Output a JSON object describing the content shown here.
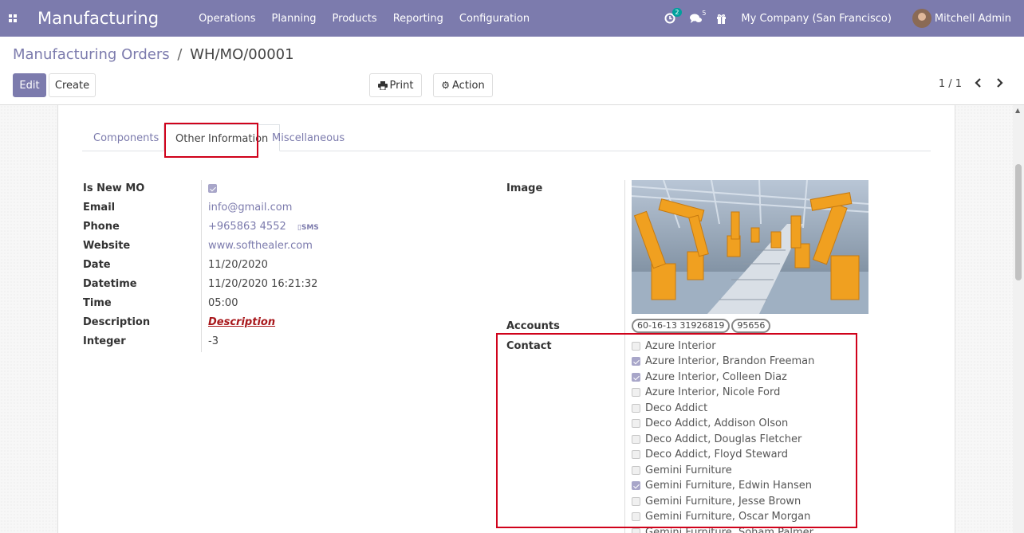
{
  "navbar": {
    "brand": "Manufacturing",
    "menu": [
      "Operations",
      "Planning",
      "Products",
      "Reporting",
      "Configuration"
    ],
    "activities_count": "2",
    "messages_count": "5",
    "company": "My Company (San Francisco)",
    "user": "Mitchell Admin"
  },
  "breadcrumb": {
    "parent": "Manufacturing Orders",
    "separator": "/",
    "current": "WH/MO/00001"
  },
  "buttons": {
    "edit": "Edit",
    "create": "Create",
    "print": "Print",
    "action": "Action"
  },
  "pager": {
    "value": "1 / 1"
  },
  "tabs": [
    "Components",
    "Other Information",
    "Miscellaneous"
  ],
  "fields": {
    "is_new_mo": {
      "label": "Is New MO",
      "checked": true
    },
    "email": {
      "label": "Email",
      "value": "info@gmail.com"
    },
    "phone": {
      "label": "Phone",
      "value": "+965863 4552",
      "sms": "SMS"
    },
    "website": {
      "label": "Website",
      "value": "www.softhealer.com"
    },
    "date": {
      "label": "Date",
      "value": "11/20/2020"
    },
    "datetime": {
      "label": "Datetime",
      "value": "11/20/2020 16:21:32"
    },
    "time": {
      "label": "Time",
      "value": "05:00"
    },
    "description": {
      "label": "Description",
      "value": "Description"
    },
    "integer": {
      "label": "Integer",
      "value": "-3"
    },
    "image": {
      "label": "Image"
    },
    "accounts": {
      "label": "Accounts",
      "tags": [
        "60-16-13 31926819",
        "95656"
      ]
    },
    "contact": {
      "label": "Contact"
    }
  },
  "contacts": [
    {
      "name": "Azure Interior",
      "checked": false
    },
    {
      "name": "Azure Interior, Brandon Freeman",
      "checked": true
    },
    {
      "name": "Azure Interior, Colleen Diaz",
      "checked": true
    },
    {
      "name": "Azure Interior, Nicole Ford",
      "checked": false
    },
    {
      "name": "Deco Addict",
      "checked": false
    },
    {
      "name": "Deco Addict, Addison Olson",
      "checked": false
    },
    {
      "name": "Deco Addict, Douglas Fletcher",
      "checked": false
    },
    {
      "name": "Deco Addict, Floyd Steward",
      "checked": false
    },
    {
      "name": "Gemini Furniture",
      "checked": false
    },
    {
      "name": "Gemini Furniture, Edwin Hansen",
      "checked": true
    },
    {
      "name": "Gemini Furniture, Jesse Brown",
      "checked": false
    },
    {
      "name": "Gemini Furniture, Oscar Morgan",
      "checked": false
    },
    {
      "name": "Gemini Furniture, Soham Palmer",
      "checked": false
    }
  ],
  "colors": {
    "brand": "#7c7bad",
    "highlight": "#d0021b",
    "robot": "#f0a020"
  }
}
